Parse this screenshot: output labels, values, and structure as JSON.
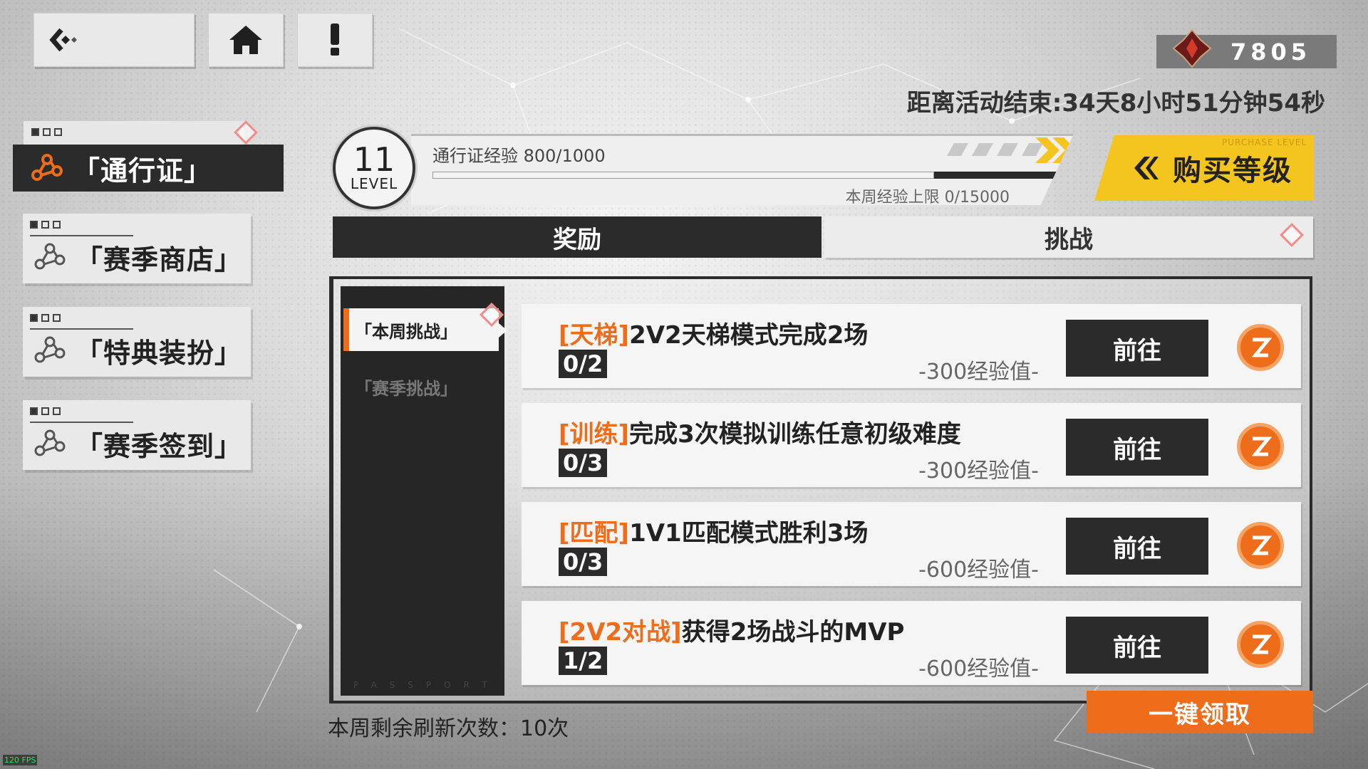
{
  "currency": {
    "value": "7805"
  },
  "countdown": "距离活动结束:34天8小时51分钟54秒",
  "sidebar": {
    "items": [
      {
        "label": "「通行证」",
        "active": true
      },
      {
        "label": "「赛季商店」",
        "active": false
      },
      {
        "label": "「特典装扮」",
        "active": false
      },
      {
        "label": "「赛季签到」",
        "active": false
      }
    ]
  },
  "level": {
    "number": "11",
    "label": "LEVEL",
    "exp_text": "通行证经验 800/1000",
    "exp_progress": 0.8,
    "weekly_cap": "本周经验上限 0/15000"
  },
  "buy": {
    "label": "购买等级",
    "tag": "PURCHASE LEVEL"
  },
  "tabs": [
    {
      "label": "奖励",
      "active": true
    },
    {
      "label": "挑战",
      "active": false
    }
  ],
  "subnav": {
    "items": [
      {
        "label": "「本周挑战」",
        "active": true
      },
      {
        "label": "「赛季挑战」",
        "active": false
      }
    ],
    "watermark": "PASSPORT"
  },
  "tasks": [
    {
      "tag": "[天梯]",
      "title": "2V2天梯模式完成2场",
      "progress": "0/2",
      "reward": "-300经验值-",
      "button": "前往"
    },
    {
      "tag": "[训练]",
      "title": "完成3次模拟训练任意初级难度",
      "progress": "0/3",
      "reward": "-300经验值-",
      "button": "前往"
    },
    {
      "tag": "[匹配]",
      "title": "1V1匹配模式胜利3场",
      "progress": "0/3",
      "reward": "-600经验值-",
      "button": "前往"
    },
    {
      "tag": "[2V2对战]",
      "title": "获得2场战斗的MVP",
      "progress": "1/2",
      "reward": "-600经验值-",
      "button": "前往"
    }
  ],
  "claim_all": "一键领取",
  "refresh_text": "本周剩余刷新次数：10次",
  "fps": "120 FPS",
  "colors": {
    "accent": "#ee6d1b",
    "gold": "#f4c51f",
    "dark": "#2b2b2b"
  }
}
